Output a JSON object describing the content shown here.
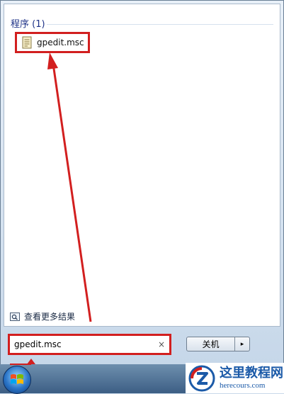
{
  "results": {
    "group_title": "程序 (1)",
    "item_label": "gpedit.msc",
    "item_icon": "msc-file-icon",
    "see_more": "查看更多结果"
  },
  "search": {
    "value": "gpedit.msc",
    "clear_glyph": "×"
  },
  "shutdown": {
    "label": "关机",
    "arrow_glyph": "▸"
  },
  "watermark": {
    "cn": "这里教程网",
    "en": "herecours.com"
  },
  "colors": {
    "highlight_red": "#d21f1f",
    "group_title_blue": "#1e3287",
    "brand_blue": "#1b5aa8"
  }
}
